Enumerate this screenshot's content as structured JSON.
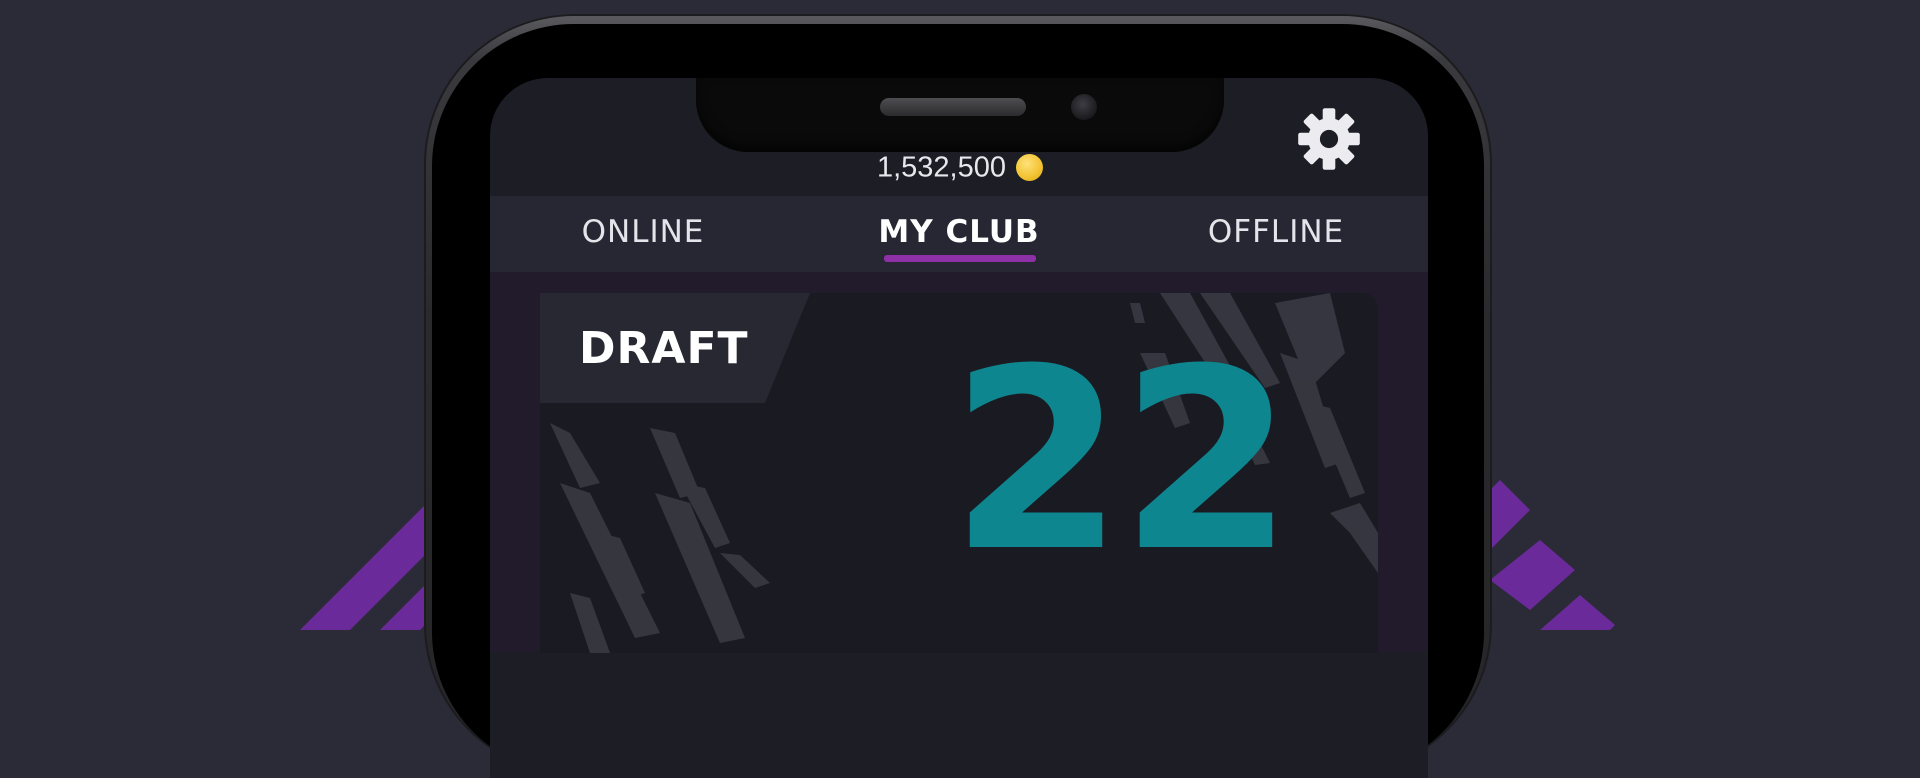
{
  "header": {
    "balance": "1,532,500",
    "coin_icon": "coin-icon",
    "settings_icon": "gear-icon"
  },
  "tabs": [
    {
      "label": "ONLINE",
      "active": false
    },
    {
      "label": "MY CLUB",
      "active": true
    },
    {
      "label": "OFFLINE",
      "active": false
    }
  ],
  "card": {
    "label": "DRAFT",
    "number": "22"
  },
  "colors": {
    "background": "#2b2a37",
    "accent_purple": "#8e30a6",
    "number_teal": "#0e8690",
    "coin_gold": "#f2c230"
  }
}
